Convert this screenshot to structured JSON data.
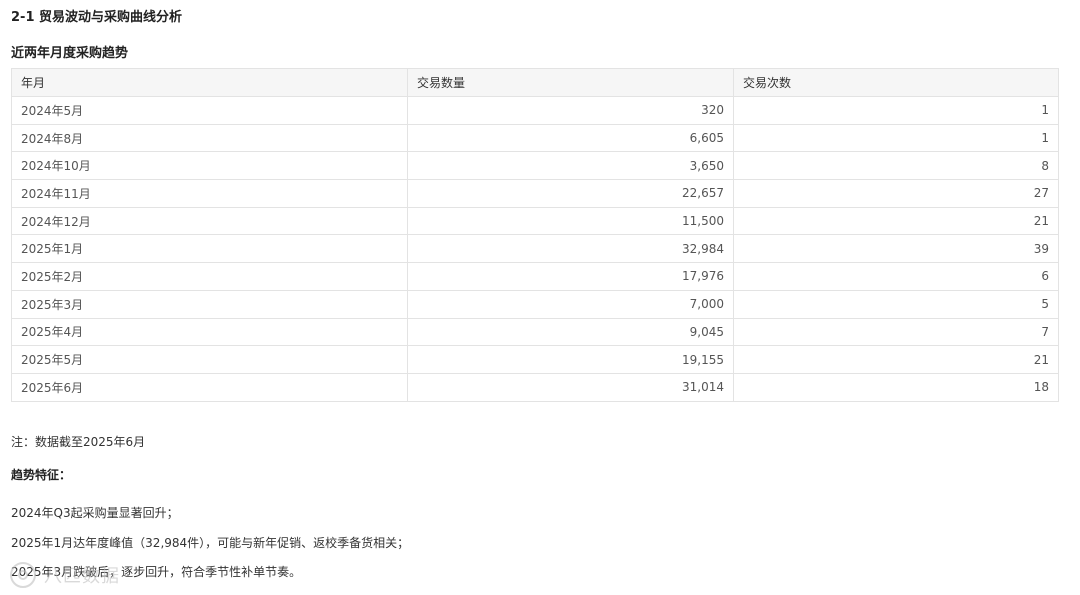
{
  "section_title": "2-1 贸易波动与采购曲线分析",
  "table_title": "近两年月度采购趋势",
  "table": {
    "headers": [
      "年月",
      "交易数量",
      "交易次数"
    ],
    "rows": [
      [
        "2024年5月",
        "320",
        "1"
      ],
      [
        "2024年8月",
        "6,605",
        "1"
      ],
      [
        "2024年10月",
        "3,650",
        "8"
      ],
      [
        "2024年11月",
        "22,657",
        "27"
      ],
      [
        "2024年12月",
        "11,500",
        "21"
      ],
      [
        "2025年1月",
        "32,984",
        "39"
      ],
      [
        "2025年2月",
        "17,976",
        "6"
      ],
      [
        "2025年3月",
        "7,000",
        "5"
      ],
      [
        "2025年4月",
        "9,045",
        "7"
      ],
      [
        "2025年5月",
        "19,155",
        "21"
      ],
      [
        "2025年6月",
        "31,014",
        "18"
      ]
    ]
  },
  "note": "注：数据截至2025年6月",
  "trend_heading": "趋势特征：",
  "trend_items": [
    "2024年Q3起采购量显著回升；",
    "2025年1月达年度峰值（32,984件），可能与新年促销、返校季备货相关；",
    "2025年3月跌破后，逐步回升，符合季节性补单节奏。"
  ],
  "watermark_text": "八匹数据",
  "watermark_icon": "logo-icon"
}
